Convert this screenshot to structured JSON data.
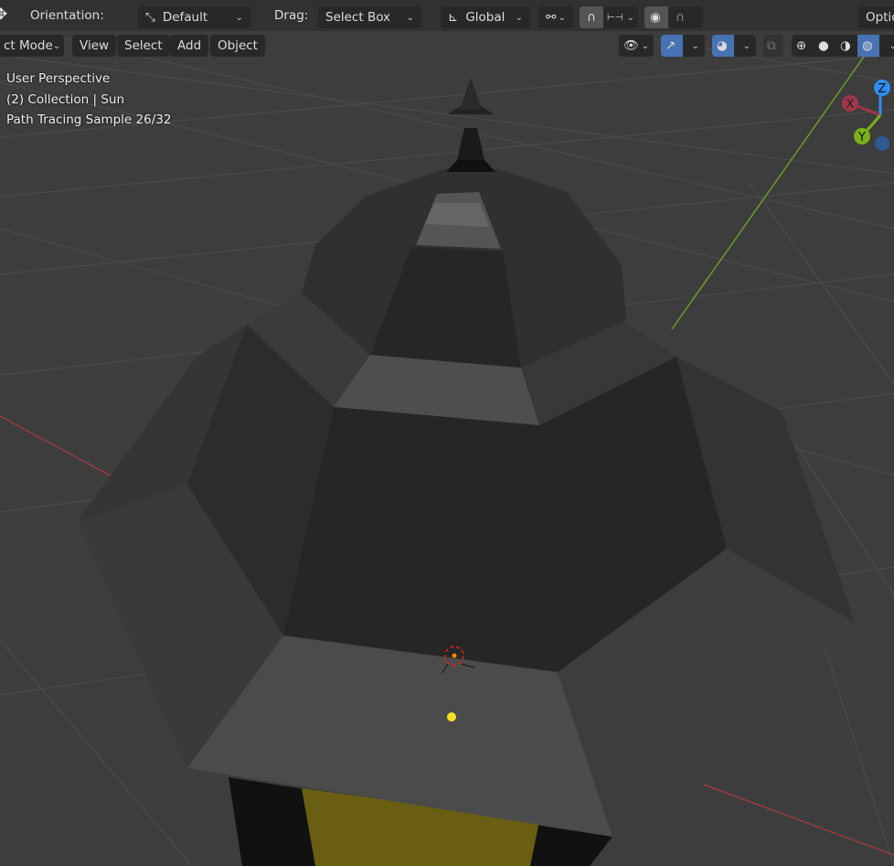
{
  "header": {
    "orientation_label": "Orientation:",
    "orientation_value": "Default",
    "drag_label": "Drag:",
    "drag_value": "Select Box",
    "transform_orientation": "Global",
    "options_label": "Optio"
  },
  "menu": {
    "mode": "ct Mode",
    "items": [
      "View",
      "Select",
      "Add",
      "Object"
    ]
  },
  "overlay": {
    "line1": "User Perspective",
    "line2": "(2) Collection | Sun",
    "line3": "Path Tracing Sample 26/32"
  },
  "render_progress": {
    "current": 26,
    "total": 32
  },
  "gizmo": {
    "x": "X",
    "y": "Y",
    "z": "Z",
    "colors": {
      "x": "#a0374a",
      "y": "#7bb01a",
      "z": "#2f8ef0"
    }
  },
  "colors": {
    "accent": "#4772b3",
    "background": "#3d3d3d"
  }
}
